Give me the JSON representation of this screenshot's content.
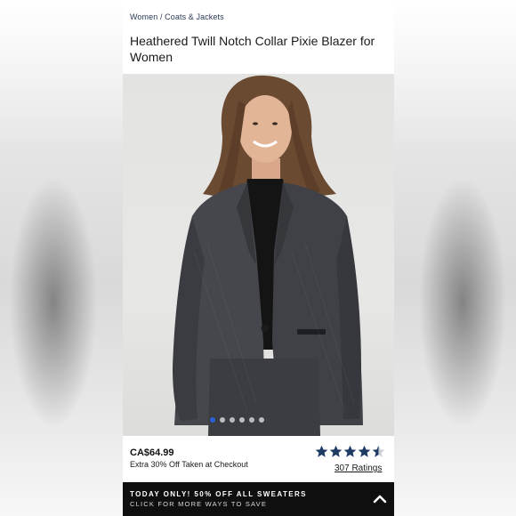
{
  "breadcrumb": {
    "level1": "Women",
    "separator": " / ",
    "level2": "Coats & Jackets"
  },
  "product": {
    "title": "Heathered Twill Notch Collar Pixie Blazer for Women",
    "price": "CA$64.99",
    "promo": "Extra 30% Off Taken at Checkout",
    "rating": 4.5,
    "ratings_count": "307 Ratings"
  },
  "gallery": {
    "image_count": 6,
    "active_index": 0
  },
  "banner": {
    "headline": "TODAY ONLY! 50% OFF ALL SWEATERS",
    "subline": "CLICK FOR MORE WAYS TO SAVE",
    "icon": "chevron-up-icon"
  },
  "colors": {
    "star": "#1f3b64",
    "banner_bg": "#0f0f10",
    "dot_active": "#2b61d5",
    "breadcrumb_text": "#2b3a55"
  }
}
